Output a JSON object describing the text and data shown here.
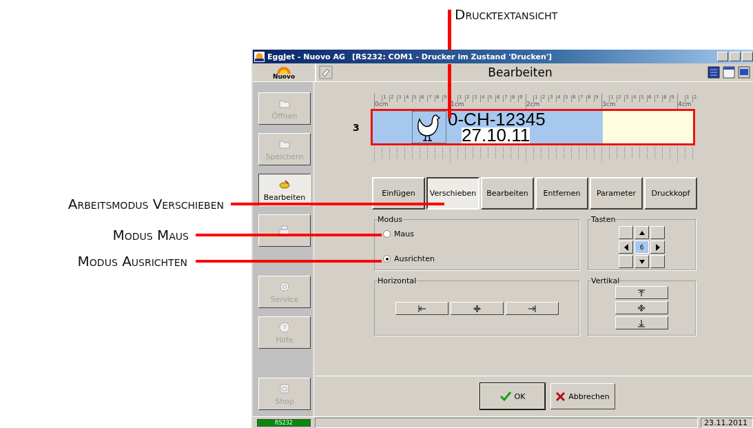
{
  "callouts": [
    {
      "label": "Drucktextansicht"
    },
    {
      "label": "Arbeitsmodus Verschieben"
    },
    {
      "label": "Modus Maus"
    },
    {
      "label": "Modus Ausrichten"
    }
  ],
  "window": {
    "app": "EggJet - Nuovo AG",
    "status": "[RS232: COM1 - Drucker im Zustand 'Drucken']"
  },
  "logo": {
    "text": "Nuovo"
  },
  "header": {
    "title": "Bearbeiten"
  },
  "sidebar": {
    "groups": [
      {
        "items": [
          {
            "label": "Öffnen",
            "kind": "folder",
            "selected": false,
            "disabled": true
          },
          {
            "label": "Speichern",
            "kind": "folder",
            "selected": false,
            "disabled": true
          },
          {
            "label": "Bearbeiten",
            "kind": "edit",
            "selected": true,
            "disabled": false
          },
          {
            "kind": "printer",
            "selected": false,
            "disabled": true
          }
        ]
      },
      {
        "items": [
          {
            "label": "Service",
            "kind": "gear",
            "selected": false,
            "disabled": true
          },
          {
            "label": "Hilfe",
            "kind": "help",
            "selected": false,
            "disabled": true
          }
        ]
      },
      {
        "items": [
          {
            "label": "Shop",
            "kind": "shop",
            "selected": false,
            "disabled": true
          }
        ]
      }
    ]
  },
  "ruler": {
    "segments": [
      {
        "label": "0cm",
        "marks": [
          "1",
          "2",
          "3",
          "4",
          "5",
          "6",
          "7",
          "8",
          "9"
        ]
      },
      {
        "label": "1cm",
        "marks": [
          "1",
          "2",
          "3",
          "4",
          "5",
          "6",
          "7",
          "8",
          "9"
        ]
      },
      {
        "label": "2cm",
        "marks": [
          "1",
          "2",
          "3",
          "4",
          "5",
          "6",
          "7",
          "8",
          "9"
        ]
      },
      {
        "label": "3cm",
        "marks": [
          "1",
          "2",
          "3",
          "4",
          "5",
          "6",
          "7",
          "8",
          "9"
        ]
      },
      {
        "label": "4cm",
        "marks": [
          "1",
          "2"
        ]
      }
    ]
  },
  "preview": {
    "row": "3",
    "line_1": "0-CH-12345",
    "line_2": "27.10.11"
  },
  "tabs": [
    {
      "label": "Einfügen",
      "selected": false
    },
    {
      "label": "Verschieben",
      "selected": true
    },
    {
      "label": "Bearbeiten",
      "selected": false
    },
    {
      "label": "Entfernen",
      "selected": false
    },
    {
      "label": "Parameter",
      "selected": false
    },
    {
      "label": "Druckkopf",
      "selected": false
    }
  ],
  "modus": {
    "title": "Modus",
    "options": [
      {
        "label": "Maus",
        "selected": false
      },
      {
        "label": "Ausrichten",
        "selected": true
      }
    ]
  },
  "tasten": {
    "title": "Tasten",
    "value": "6"
  },
  "horizontal": {
    "title": "Horizontal"
  },
  "vertikal": {
    "title": "Vertikal"
  },
  "buttons": [
    {
      "label": "OK",
      "kind": "ok"
    },
    {
      "label": "Abbrechen",
      "kind": "cancel"
    }
  ],
  "status_bar": {
    "port": "RS232",
    "date": "23.11.2011"
  }
}
